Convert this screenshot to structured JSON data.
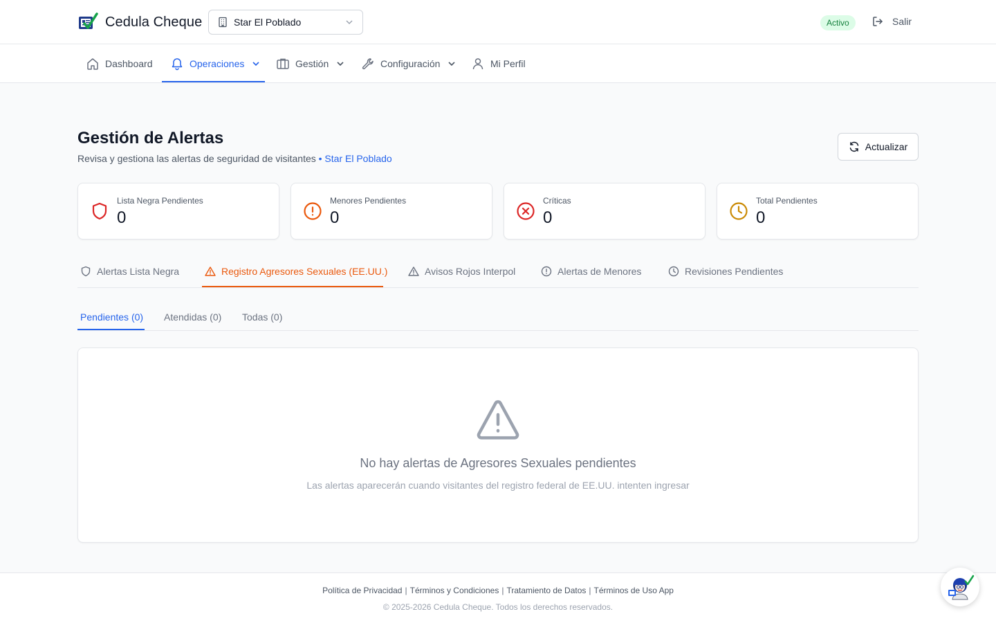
{
  "app": {
    "name": "Cedula Cheque"
  },
  "site_selector": {
    "value": "Star El Poblado"
  },
  "status": {
    "label": "Activo"
  },
  "logout": {
    "label": "Salir"
  },
  "nav": {
    "dashboard": "Dashboard",
    "operaciones": "Operaciones",
    "gestion": "Gestión",
    "configuracion": "Configuración",
    "perfil": "Mi Perfil"
  },
  "header": {
    "title": "Gestión de Alertas",
    "subtitle": "Revisa y gestiona las alertas de seguridad de visitantes",
    "site": "• Star El Poblado",
    "refresh_label": "Actualizar"
  },
  "stats": [
    {
      "label": "Lista Negra Pendientes",
      "value": "0",
      "icon": "shield-icon",
      "color": "#dc2626"
    },
    {
      "label": "Menores Pendientes",
      "value": "0",
      "icon": "alert-circle-icon",
      "color": "#ea580c"
    },
    {
      "label": "Críticas",
      "value": "0",
      "icon": "x-circle-icon",
      "color": "#dc2626"
    },
    {
      "label": "Total Pendientes",
      "value": "0",
      "icon": "clock-icon",
      "color": "#ca8a04"
    }
  ],
  "tabs": [
    "Alertas Lista Negra",
    "Registro Agresores Sexuales (EE.UU.)",
    "Avisos Rojos Interpol",
    "Alertas de Menores",
    "Revisiones Pendientes"
  ],
  "active_tab_color": "#ea580c",
  "subtabs": [
    "Pendientes (0)",
    "Atendidas (0)",
    "Todas (0)"
  ],
  "empty_state": {
    "icon": "warning-triangle-icon",
    "title": "No hay alertas de Agresores Sexuales pendientes",
    "description": "Las alertas aparecerán cuando visitantes del registro federal de EE.UU. intenten ingresar"
  },
  "footer": {
    "links": [
      "Política de Privacidad",
      "Términos y Condiciones",
      "Tratamiento de Datos",
      "Términos de Uso App"
    ],
    "separator": "|",
    "copyright": "© 2025-2026 Cedula Cheque.  Todos los derechos reservados."
  },
  "colors": {
    "primary": "#2563eb",
    "accent_orange": "#ea580c",
    "status_bg": "#dcfce7",
    "status_text": "#15803d"
  }
}
